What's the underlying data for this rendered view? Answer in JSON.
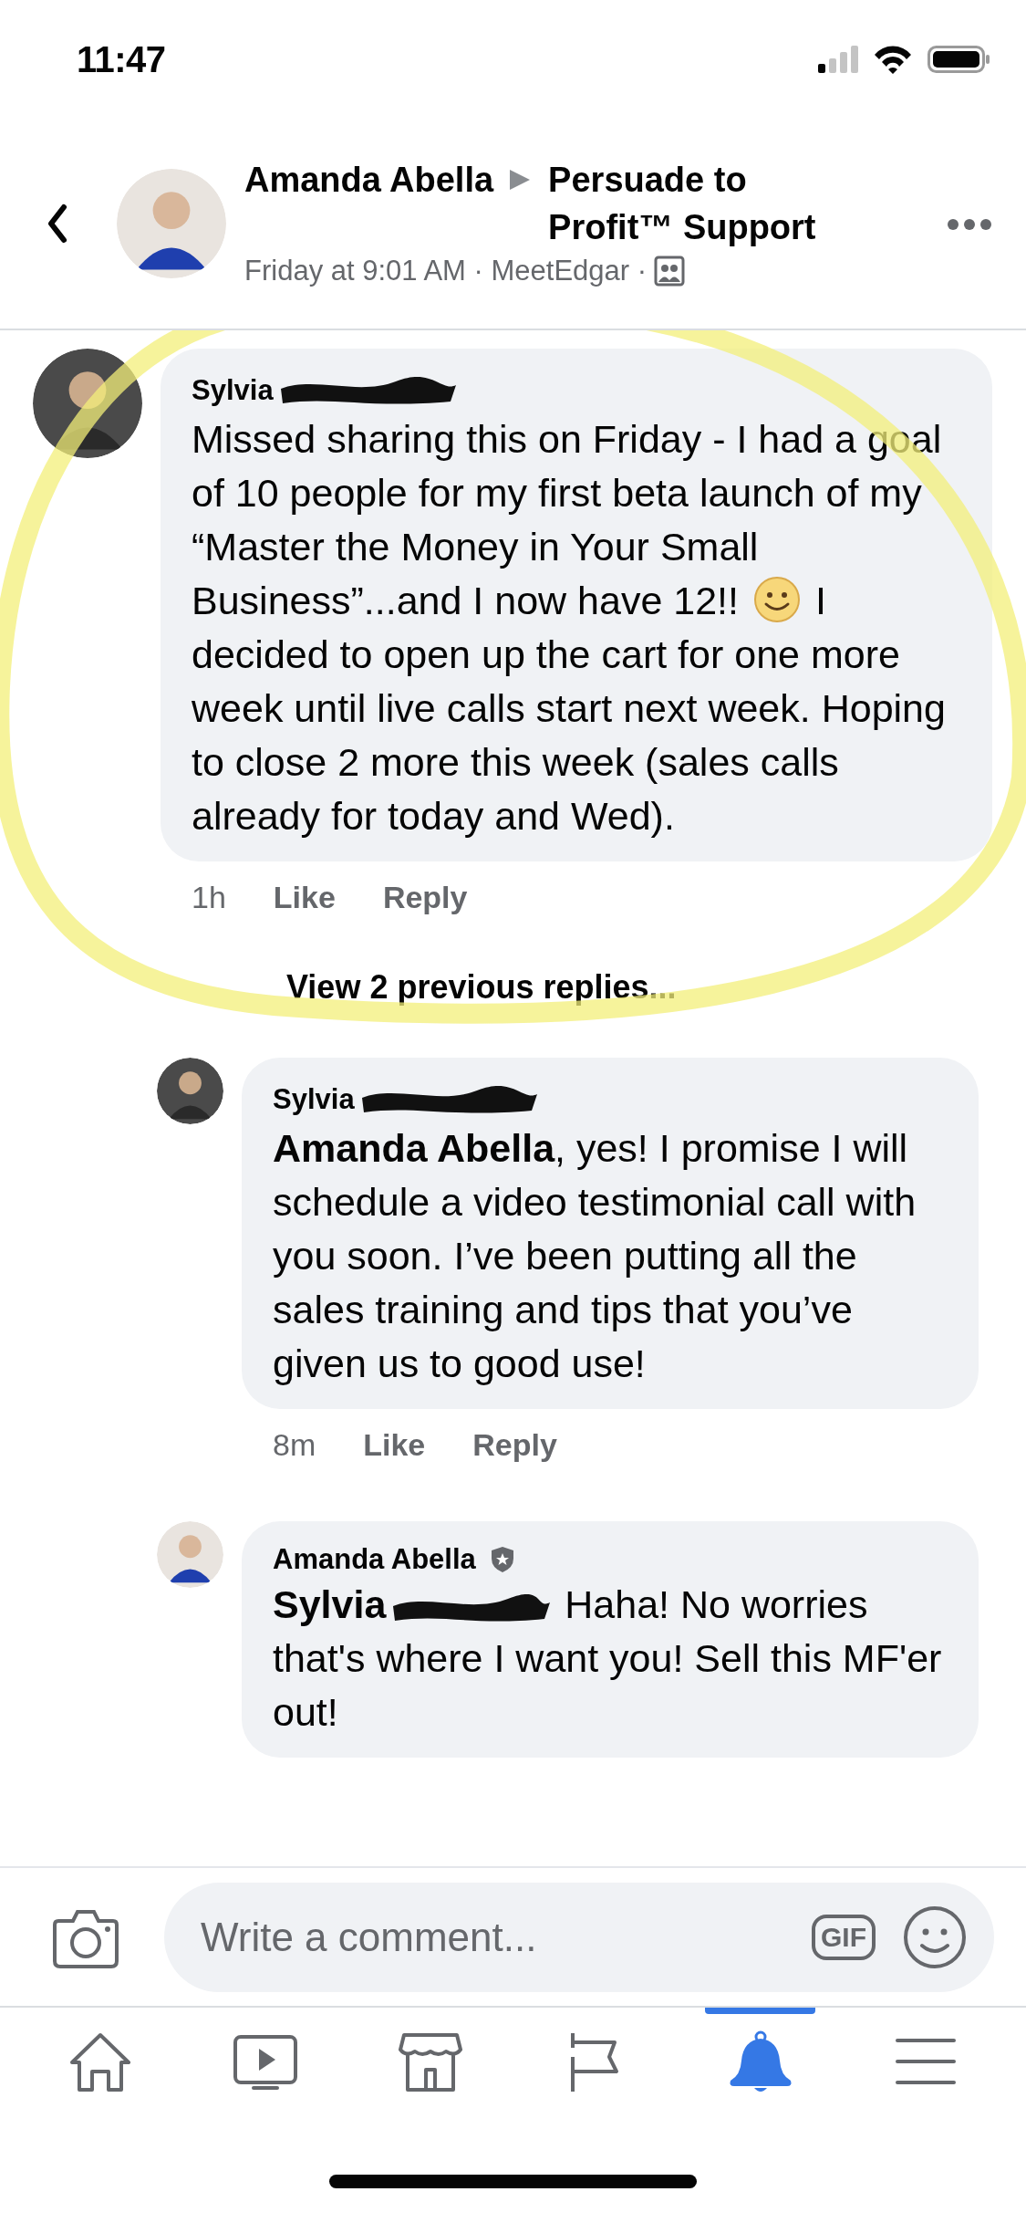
{
  "status_bar": {
    "time": "11:47"
  },
  "header": {
    "author": "Amanda Abella",
    "group": "Persuade to Profit™ Support",
    "meta": "Friday at 9:01 AM · MeetEdgar ·"
  },
  "comments": [
    {
      "author": "Sylvia",
      "author_redacted": true,
      "admin_badge": false,
      "text_parts": [
        "Missed sharing this on Friday - I had a goal of 10 people for my first beta launch of my “Master the Money in Your Small Business”...and I now have 12!!",
        "I decided to open up the cart for one more week until live calls start next week. Hoping to close 2 more this week (sales calls already for today and Wed)."
      ],
      "time": "1h",
      "actions": [
        "Like",
        "Reply"
      ],
      "highlighted": true,
      "view_more": "View 2 previous replies...",
      "children": [
        {
          "author": "Sylvia",
          "author_redacted": true,
          "admin_badge": false,
          "mention": "Amanda Abella",
          "mention_redacted": false,
          "text_parts": [
            ", yes! I promise I will schedule a video testimonial call with you soon. I’ve been putting all the sales training and tips that you’ve given us to good use!"
          ],
          "time": "8m",
          "actions": [
            "Like",
            "Reply"
          ]
        },
        {
          "author": "Amanda Abella",
          "author_redacted": false,
          "admin_badge": true,
          "mention": "Sylvia",
          "mention_redacted": true,
          "text_parts": [
            "Haha! No worries that's where I want you! Sell this MF'er out!"
          ]
        }
      ]
    }
  ],
  "composer": {
    "placeholder": "Write a comment...",
    "gif_label": "GIF"
  },
  "tabs": [
    {
      "kind": "home",
      "selected": false
    },
    {
      "kind": "video",
      "selected": false
    },
    {
      "kind": "marketplace",
      "selected": false
    },
    {
      "kind": "pages",
      "selected": false
    },
    {
      "kind": "notifications",
      "selected": true
    },
    {
      "kind": "menu",
      "selected": false
    }
  ]
}
